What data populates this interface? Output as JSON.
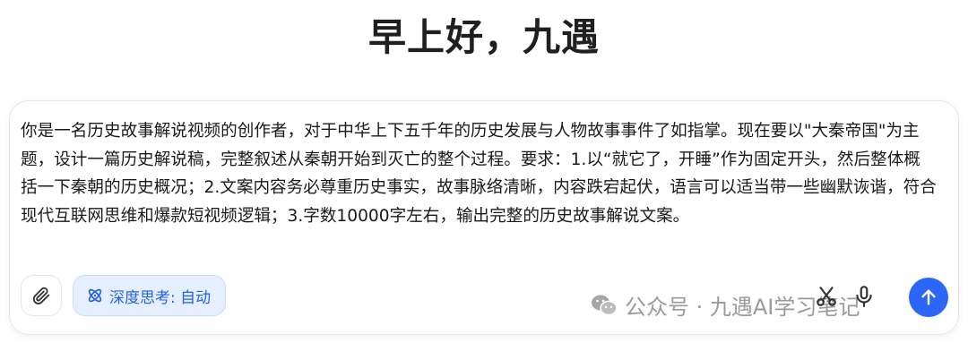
{
  "greeting": "早上好，九遇",
  "composer": {
    "prompt_text": "你是一名历史故事解说视频的创作者，对于中华上下五千年的历史发展与人物故事事件了如指掌。现在要以\"大秦帝国\"为主题，设计一篇历史解说稿，完整叙述从秦朝开始到灭亡的整个过程。要求：1.以“就它了，开睡”作为固定开头，然后整体概括一下秦朝的历史概况；2.文案内容务必尊重历史事实，故事脉络清晰，内容跌宕起伏，语言可以适当带一些幽默诙谐，符合现代互联网思维和爆款短视频逻辑；3.字数10000字左右，输出完整的历史故事解说文案。",
    "deep_think_label": "深度思考: 自动"
  },
  "watermark": "公众号 · 九遇AI学习笔记",
  "icons": {
    "attach": "paperclip-icon",
    "deep_think": "atom-icon",
    "scissors": "scissors-icon",
    "mic": "microphone-icon",
    "send": "arrow-up-icon",
    "wechat": "wechat-icon"
  },
  "colors": {
    "accent": "#2b66f6",
    "deep_think_bg": "#e6efff",
    "deep_think_text": "#2461e3"
  }
}
